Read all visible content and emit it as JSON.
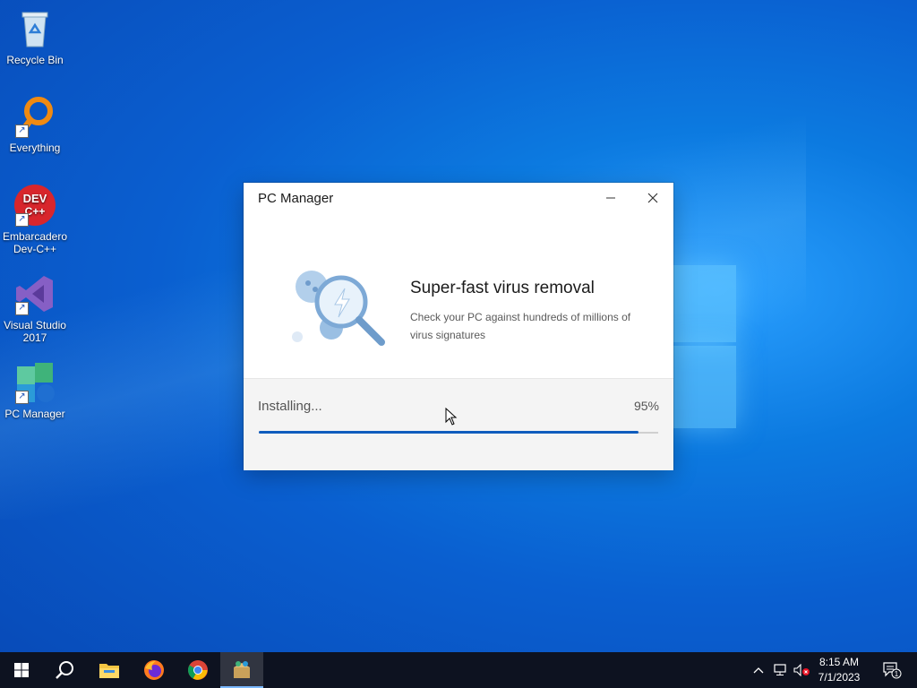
{
  "desktop": {
    "icons": [
      {
        "label": "Recycle Bin",
        "icon": "recycle-bin-icon"
      },
      {
        "label": "Everything",
        "icon": "everything-search-icon"
      },
      {
        "label": "Embarcadero Dev-C++",
        "icon": "devcpp-icon",
        "badge": "DEV C++"
      },
      {
        "label": "Visual Studio 2017",
        "icon": "visual-studio-icon"
      },
      {
        "label": "PC Manager",
        "icon": "pc-manager-icon"
      }
    ]
  },
  "dialog": {
    "title": "PC Manager",
    "heading": "Super-fast virus removal",
    "description": "Check your PC against hundreds of millions of virus signatures",
    "status": "Installing...",
    "progress_text": "95%",
    "progress": 0.95,
    "accent": "#0f5cbd"
  },
  "taskbar": {
    "apps": [
      "start-icon",
      "search-icon",
      "file-explorer-icon",
      "firefox-icon",
      "chrome-icon",
      "pc-manager-installer-icon"
    ],
    "time": "8:15 AM",
    "date": "7/1/2023",
    "notification_count": "1"
  }
}
